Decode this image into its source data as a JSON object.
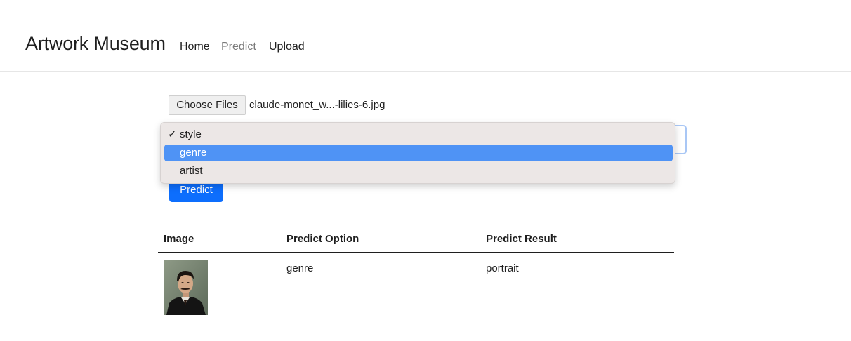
{
  "navbar": {
    "brand": "Artwork Museum",
    "links": [
      {
        "label": "Home",
        "active": false
      },
      {
        "label": "Predict",
        "active": true
      },
      {
        "label": "Upload",
        "active": false
      }
    ]
  },
  "form": {
    "file_button_label": "Choose Files",
    "file_name": "claude-monet_w...-lilies-6.jpg",
    "dropdown": {
      "options": [
        {
          "label": "style",
          "checked": true,
          "highlighted": false
        },
        {
          "label": "genre",
          "checked": false,
          "highlighted": true
        },
        {
          "label": "artist",
          "checked": false,
          "highlighted": false
        }
      ],
      "check_glyph": "✓"
    },
    "predict_button_label": "Predict"
  },
  "table": {
    "headers": [
      "Image",
      "Predict Option",
      "Predict Result"
    ],
    "rows": [
      {
        "image_icon": "portrait-thumbnail",
        "option": "genre",
        "result": "portrait"
      }
    ]
  },
  "colors": {
    "highlight": "#4f93f5",
    "primary_button": "#0d6efd",
    "dropdown_bg": "#ece7e6"
  }
}
